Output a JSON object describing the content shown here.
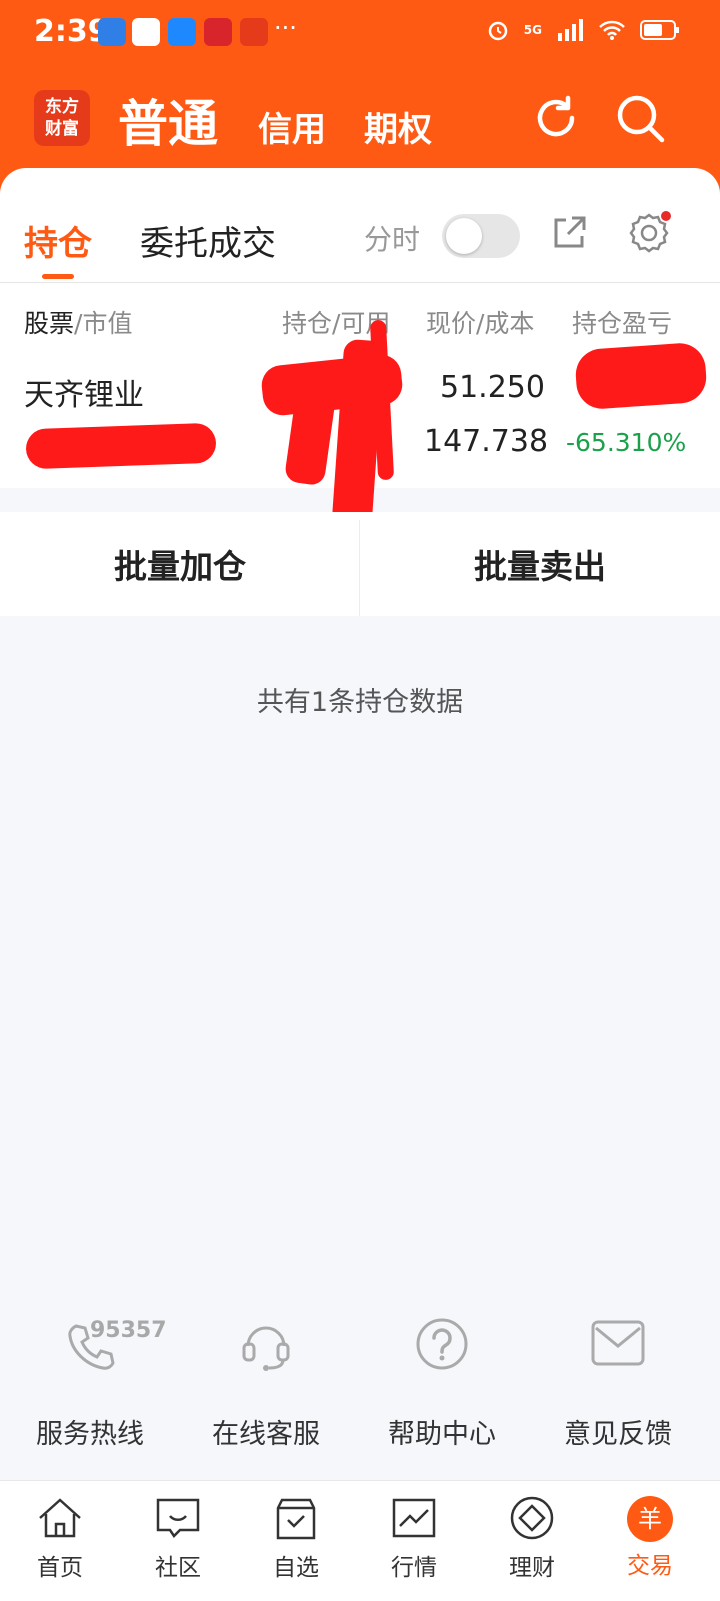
{
  "status": {
    "time": "2:39",
    "more": "···",
    "network": "5G"
  },
  "header": {
    "logo_line1": "东方",
    "logo_line2": "财富",
    "account_tabs": [
      "普通",
      "信用",
      "期权"
    ]
  },
  "tabs": {
    "positions": "持仓",
    "orders": "委托成交",
    "fenshi": "分时"
  },
  "table": {
    "headers": {
      "stock": "股票",
      "market_value": "/市值",
      "holding": "持仓/可用",
      "price": "现价/成本",
      "pnl": "持仓盈亏"
    },
    "rows": [
      {
        "name": "天齐锂业",
        "current_price": "51.250",
        "cost": "147.738",
        "pnl_pct": "-65.310%"
      }
    ]
  },
  "batch": {
    "add": "批量加仓",
    "sell": "批量卖出"
  },
  "summary": "共有1条持仓数据",
  "services": {
    "hotline_number": "95357",
    "items": [
      "服务热线",
      "在线客服",
      "帮助中心",
      "意见反馈"
    ]
  },
  "nav": {
    "items": [
      "首页",
      "社区",
      "自选",
      "行情",
      "理财",
      "交易"
    ],
    "trade_icon": "羊"
  },
  "colors": {
    "accent": "#ff5a14",
    "gain_down": "#1aa14a"
  }
}
